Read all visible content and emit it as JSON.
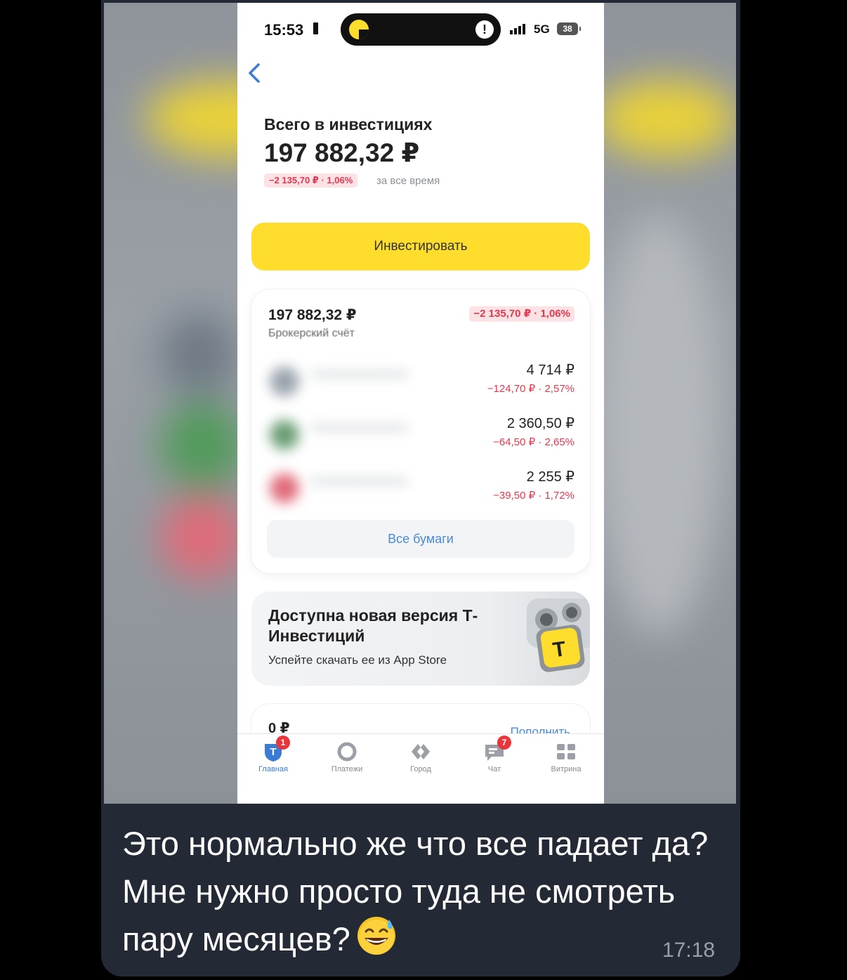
{
  "status_bar": {
    "time": "15:53",
    "network": "5G",
    "battery": "38",
    "island_alert": "!"
  },
  "investments": {
    "title": "Всего в инвестициях",
    "total": "197 882,32 ₽",
    "change": "−2 135,70 ₽ · 1,06%",
    "period": "за все время"
  },
  "invest_button": "Инвестировать",
  "brokerage": {
    "amount": "197 882,32 ₽",
    "name": "Брокерский счёт",
    "change": "−2 135,70 ₽ · 1,06%",
    "positions": [
      {
        "value": "4 714 ₽",
        "change": "−124,70 ₽ · 2,57%",
        "logo_color": "#9aa3ad"
      },
      {
        "value": "2 360,50 ₽",
        "change": "−64,50 ₽ · 2,65%",
        "logo_color": "#6a9e74"
      },
      {
        "value": "2 255 ₽",
        "change": "−39,50 ₽ · 1,72%",
        "logo_color": "#e06a7a"
      }
    ],
    "all_papers": "Все бумаги"
  },
  "promo": {
    "title": "Доступна новая версия Т-Инвестиций",
    "subtitle": "Успейте скачать ее из App Store",
    "logo_letter": "Т"
  },
  "second_account": {
    "amount": "0 ₽",
    "action": "Пополнить"
  },
  "tabbar": {
    "tabs": [
      {
        "label": "Главная",
        "badge": "1",
        "icon": "home-shield-icon"
      },
      {
        "label": "Платежи",
        "badge": "",
        "icon": "payments-icon"
      },
      {
        "label": "Город",
        "badge": "",
        "icon": "city-icon"
      },
      {
        "label": "Чат",
        "badge": "7",
        "icon": "chat-icon"
      },
      {
        "label": "Витрина",
        "badge": "",
        "icon": "showcase-icon"
      }
    ]
  },
  "message": {
    "text": "Это нормально же что все падает да? Мне нужно просто туда не смотреть пару месяцев?",
    "emoji": "grinning-sweat-emoji",
    "time": "17:18"
  },
  "colors": {
    "accent_yellow": "#ffdd2d",
    "loss_red": "#e03a4f",
    "link_blue": "#4a8ad8",
    "bubble": "#242a35"
  }
}
